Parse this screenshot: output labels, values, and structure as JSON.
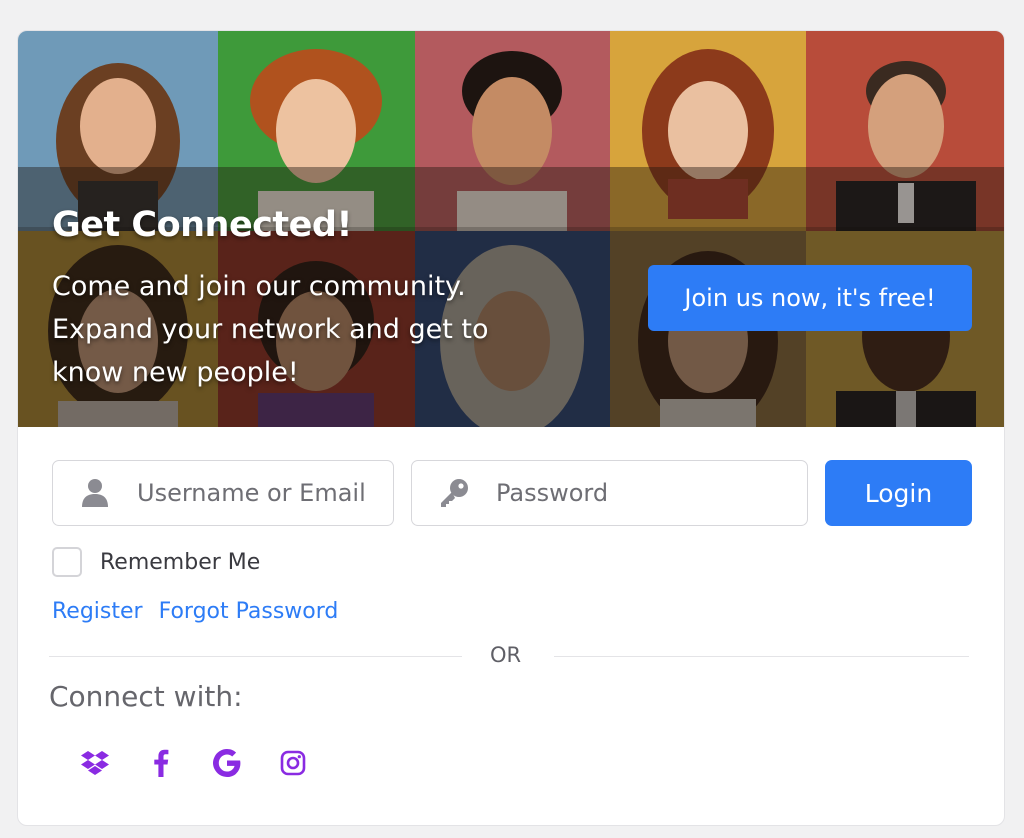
{
  "hero": {
    "title": "Get Connected!",
    "text_lines": [
      "Come and join our community.",
      "Expand your network and get to",
      "know new people!"
    ],
    "cta_label": "Join us now, it's free!"
  },
  "login": {
    "username_placeholder": "Username or Email",
    "password_placeholder": "Password",
    "login_label": "Login",
    "remember_label": "Remember Me",
    "remember_checked": false,
    "register_label": "Register",
    "forgot_label": "Forgot Password"
  },
  "divider": {
    "label": "OR"
  },
  "social": {
    "title": "Connect with:",
    "icons": [
      "dropbox-icon",
      "facebook-icon",
      "google-icon",
      "instagram-icon"
    ]
  },
  "colors": {
    "accent": "#2d7cf6",
    "social_icon": "#8a2be2",
    "page_bg": "#f1f1f2"
  }
}
